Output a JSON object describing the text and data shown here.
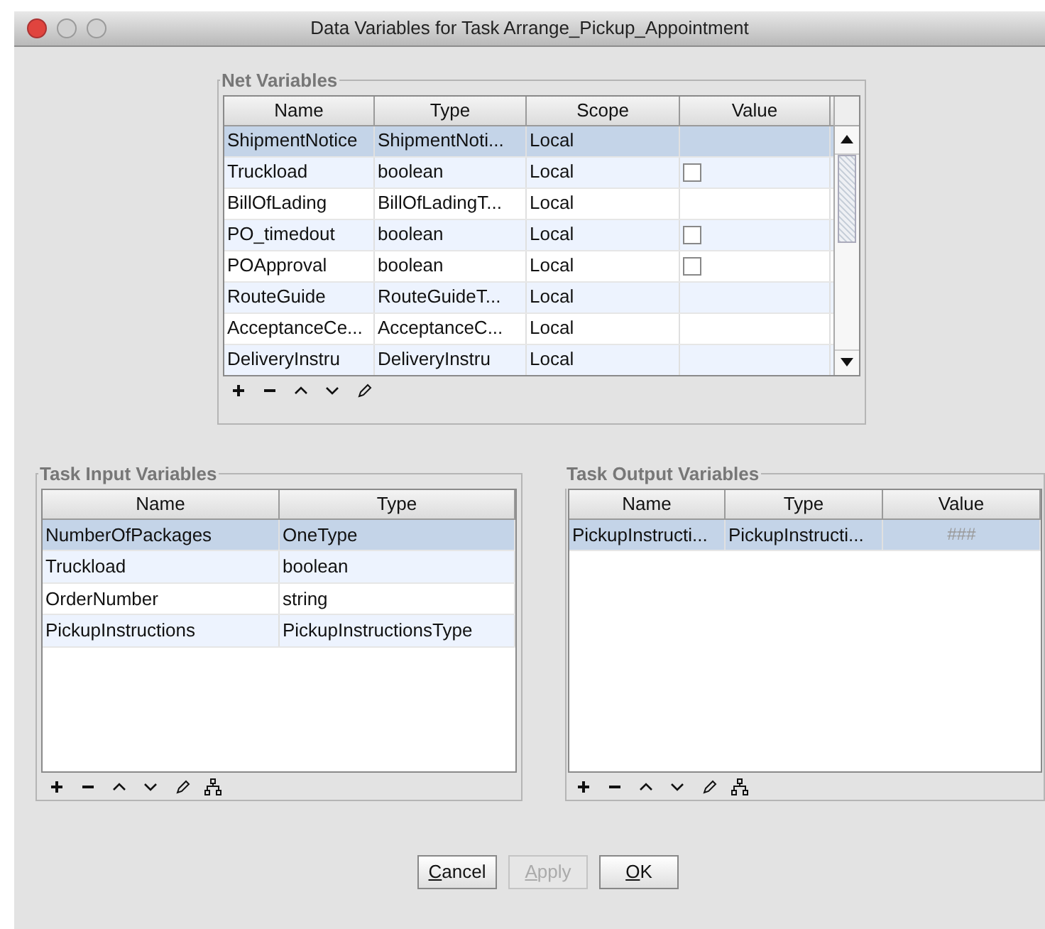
{
  "window": {
    "title": "Data Variables for Task Arrange_Pickup_Appointment",
    "active": true
  },
  "net_variables": {
    "title": "Net Variables",
    "columns": [
      "Name",
      "Type",
      "Scope",
      "Value"
    ],
    "rows": [
      {
        "name": "ShipmentNotice",
        "type": "ShipmentNoti...",
        "scope": "Local",
        "selected": true
      },
      {
        "name": "Truckload",
        "type": "boolean",
        "scope": "Local",
        "selected": false,
        "value": {
          "kind": "checkbox",
          "checked": false
        }
      },
      {
        "name": "BillOfLading",
        "type": "BillOfLadingT...",
        "scope": "Local",
        "selected": false
      },
      {
        "name": "PO_timedout",
        "type": "boolean",
        "scope": "Local",
        "selected": false,
        "value": {
          "kind": "checkbox",
          "checked": false
        }
      },
      {
        "name": "POApproval",
        "type": "boolean",
        "scope": "Local",
        "selected": false,
        "value": {
          "kind": "checkbox",
          "checked": false
        }
      },
      {
        "name": "RouteGuide",
        "type": "RouteGuideT...",
        "scope": "Local",
        "selected": false
      },
      {
        "name": "AcceptanceCe...",
        "type": "AcceptanceC...",
        "scope": "Local",
        "selected": false
      },
      {
        "name": "DeliveryInstru",
        "type": "DeliveryInstru",
        "scope": "Local",
        "selected": false
      }
    ]
  },
  "task_input_variables": {
    "title": "Task Input Variables",
    "columns": [
      "Name",
      "Type"
    ],
    "rows": [
      {
        "name": "NumberOfPackages",
        "type": "OneType",
        "selected": true
      },
      {
        "name": "Truckload",
        "type": "boolean",
        "selected": false
      },
      {
        "name": "OrderNumber",
        "type": "string",
        "selected": false
      },
      {
        "name": "PickupInstructions",
        "type": "PickupInstructionsType",
        "selected": false
      }
    ]
  },
  "task_output_variables": {
    "title": "Task Output Variables",
    "columns": [
      "Name",
      "Type",
      "Value"
    ],
    "rows": [
      {
        "name": "PickupInstructi...",
        "type": "PickupInstructi...",
        "selected": true,
        "value": {
          "kind": "text",
          "text": "###"
        }
      }
    ]
  },
  "buttons": [
    {
      "label": "Cancel",
      "mnemonic": true,
      "disabled": false
    },
    {
      "label": "Apply",
      "mnemonic": true,
      "disabled": true
    },
    {
      "label": "OK",
      "mnemonic": true,
      "disabled": false
    }
  ]
}
